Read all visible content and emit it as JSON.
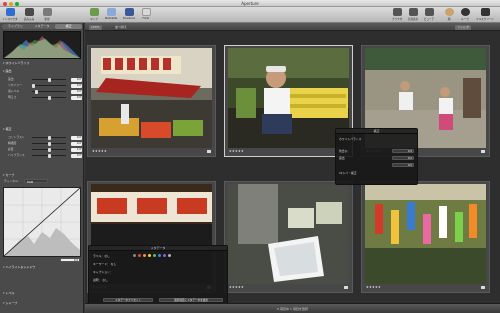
{
  "app": {
    "title": "Aperture"
  },
  "toolbar": {
    "left": [
      {
        "label": "インスペクタ",
        "icon": "inspector-icon"
      },
      {
        "label": "読み込み",
        "icon": "import-icon"
      },
      {
        "label": "新規",
        "icon": "new-icon"
      }
    ],
    "center": [
      {
        "label": "マップ",
        "icon": "map-icon"
      },
      {
        "label": "MobileMe",
        "icon": "mobileme-icon"
      },
      {
        "label": "Facebook",
        "icon": "facebook-icon"
      },
      {
        "label": "Flickr",
        "icon": "flickr-icon"
      }
    ],
    "right": [
      {
        "label": "ブラウザ",
        "icon": "browser-icon"
      },
      {
        "label": "分割表示",
        "icon": "split-view-icon"
      },
      {
        "label": "ビューア",
        "icon": "viewer-icon"
      },
      {
        "label": "顔",
        "icon": "faces-icon"
      },
      {
        "label": "ループ",
        "icon": "loupe-icon"
      },
      {
        "label": "フルスクリーン",
        "icon": "fullscreen-icon"
      }
    ]
  },
  "inspector": {
    "tabs": [
      "ライブラリ",
      "メタデータ",
      "補正"
    ],
    "active_tab": 2,
    "sections": {
      "white_balance": "ホワイトバランス",
      "exposure": "露出",
      "enhance": "補正",
      "levels": "レベル",
      "curves": "カーブ",
      "highlights_shadows": "ハイライト＆シャドウ",
      "sharpen": "シャープ"
    },
    "sliders": [
      {
        "label": "露出",
        "value": "0.0",
        "pos": 0.5
      },
      {
        "label": "リカバリー",
        "value": "0.0",
        "pos": 0.0
      },
      {
        "label": "黒レベル",
        "value": "0.0",
        "pos": 0.1
      },
      {
        "label": "明るさ",
        "value": "0.0",
        "pos": 0.5
      },
      {
        "label": "コントラスト",
        "value": "0.0",
        "pos": 0.5
      },
      {
        "label": "精細度",
        "value": "0.0",
        "pos": 0.5
      },
      {
        "label": "彩度",
        "value": "1.0",
        "pos": 0.5
      },
      {
        "label": "バイブランス",
        "value": "0.0",
        "pos": 0.5
      }
    ],
    "channel": {
      "label": "チャンネル:",
      "value": "RGB"
    },
    "curve_point": "0.0"
  },
  "browser": {
    "bar": {
      "zoom": "100%",
      "sort_label": "並べ替え",
      "filter_label": "フィルタ"
    }
  },
  "photos": [
    {
      "id": "tile-1",
      "stars": "★★★★★",
      "selected": false
    },
    {
      "id": "tile-2",
      "stars": "★★★★★",
      "selected": true
    },
    {
      "id": "tile-3",
      "stars": "★★★★★",
      "selected": false
    },
    {
      "id": "tile-4",
      "stars": "★★★★★",
      "selected": false
    },
    {
      "id": "tile-5",
      "stars": "★★★★★",
      "selected": false
    },
    {
      "id": "tile-6",
      "stars": "★★★★★",
      "selected": false
    }
  ],
  "hud_adjust": {
    "title": "補正",
    "row1": "ホワイトバランス",
    "row2": "色合い",
    "row3": "露出",
    "row4": "Iキシバ・補正",
    "v1": "0.0",
    "v2": "0.0",
    "v3": "0.0"
  },
  "hud_metadata": {
    "title": "メタデータ",
    "rows": [
      "ラベル：なし",
      "キーワード：  なし",
      "キャプション：",
      "説明：  なし"
    ],
    "buttons": [
      "メタデータプリセット",
      "選択項目にメタデータを適用"
    ]
  },
  "status": {
    "text": "6 項目中 1 項目を選択"
  }
}
